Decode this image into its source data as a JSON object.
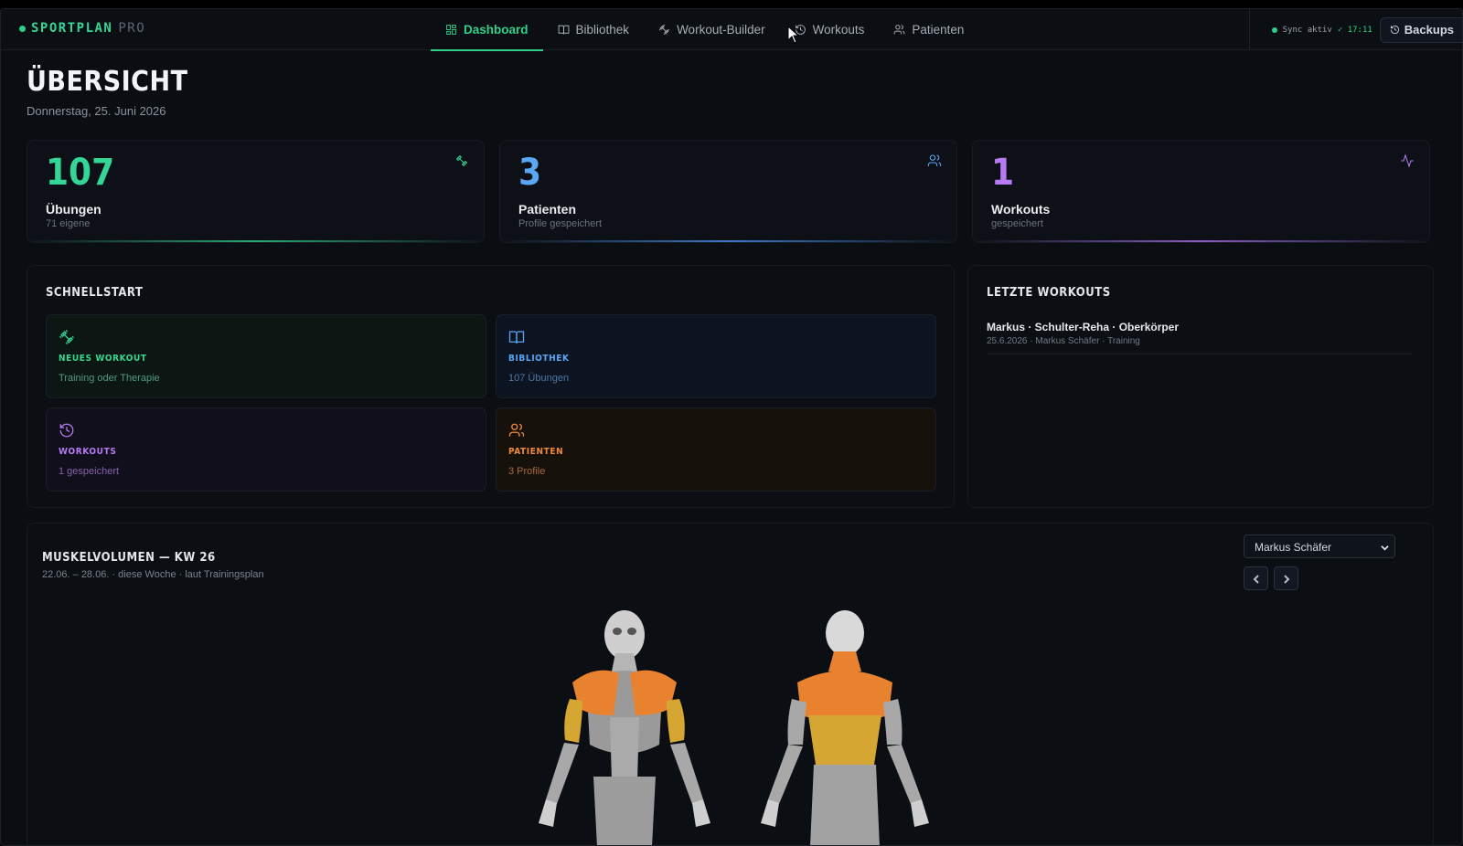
{
  "brand": {
    "name": "SPORTPLAN",
    "suffix": "PRO"
  },
  "nav": {
    "items": [
      {
        "label": "Dashboard",
        "icon": "dashboard-icon",
        "active": true
      },
      {
        "label": "Bibliothek",
        "icon": "book-icon",
        "active": false
      },
      {
        "label": "Workout-Builder",
        "icon": "dumbbell-icon",
        "active": false
      },
      {
        "label": "Workouts",
        "icon": "history-icon",
        "active": false
      },
      {
        "label": "Patienten",
        "icon": "users-icon",
        "active": false
      }
    ]
  },
  "status": {
    "sync_label": "Sync aktiv",
    "last_sync": "✓ 17:11",
    "backups_label": "Backups"
  },
  "header": {
    "title": "ÜBERSICHT",
    "date": "Donnerstag, 25. Juni 2026"
  },
  "stats": [
    {
      "value": "107",
      "label": "Übungen",
      "sub": "71 eigene",
      "color": "#33d695",
      "icon": "dumbbell-icon"
    },
    {
      "value": "3",
      "label": "Patienten",
      "sub": "Profile gespeichert",
      "color": "#5aa7f5",
      "icon": "users-icon"
    },
    {
      "value": "1",
      "label": "Workouts",
      "sub": "gespeichert",
      "color": "#b67af2",
      "icon": "activity-icon"
    }
  ],
  "quickstart": {
    "title": "SCHNELLSTART",
    "items": [
      {
        "title": "NEUES WORKOUT",
        "sub": "Training oder Therapie",
        "color": "#33d695"
      },
      {
        "title": "BIBLIOTHEK",
        "sub": "107 Übungen",
        "color": "#5aa7f5"
      },
      {
        "title": "WORKOUTS",
        "sub": "1 gespeichert",
        "color": "#b67af2"
      },
      {
        "title": "PATIENTEN",
        "sub": "3 Profile",
        "color": "#f08a3a"
      }
    ]
  },
  "recent": {
    "title": "LETZTE WORKOUTS",
    "items": [
      {
        "title": "Markus · Schulter-Reha · Oberkörper",
        "meta": "25.6.2026 · Markus Schäfer · Training"
      }
    ]
  },
  "muscle": {
    "title": "MUSKELVOLUMEN — KW 26",
    "sub": "22.06. – 28.06. · diese Woche · laut Trainingsplan",
    "patient_select": "Markus Schäfer"
  }
}
